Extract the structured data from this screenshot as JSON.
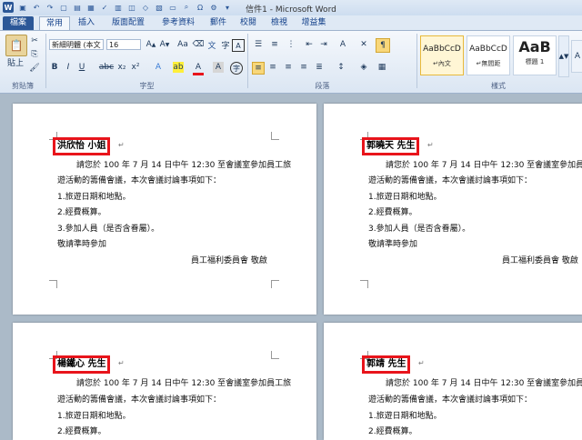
{
  "window_title": "信件1 - Microsoft Word",
  "tabs": [
    "檔案",
    "常用",
    "插入",
    "版面配置",
    "參考資料",
    "郵件",
    "校閱",
    "檢視",
    "增益集"
  ],
  "ribbon": {
    "paste_label": "貼上",
    "font_name": "新細明體 (本文",
    "font_size": "16",
    "groups": {
      "clipboard": "剪貼簿",
      "font": "字型",
      "paragraph": "段落",
      "styles": "樣式"
    },
    "style_gallery": [
      {
        "sample": "AaBbCcD",
        "name": "↵內文"
      },
      {
        "sample": "AaBbCcD",
        "name": "↵無間距"
      },
      {
        "sample": "AaB",
        "name": "標題 1"
      }
    ]
  },
  "letter": {
    "line1": "請您於 100 年 7 月 14 日中午 12:30 至會議室參加員工旅",
    "line2": "遊活動的籌備會議，本次會議討論事項如下：",
    "item1": "1.旅遊日期和地點。",
    "item2": "2.經費概算。",
    "item3": "3.參加人員（是否含眷屬）。",
    "closing": "敬請準時參加",
    "signature": "員工福利委員會  敬啟"
  },
  "para_mark": "↵",
  "recipients": [
    {
      "name": "洪欣怡 小姐"
    },
    {
      "name": "郭曉天 先生"
    },
    {
      "name": "楊鐵心 先生"
    },
    {
      "name": "郭靖 先生"
    }
  ]
}
